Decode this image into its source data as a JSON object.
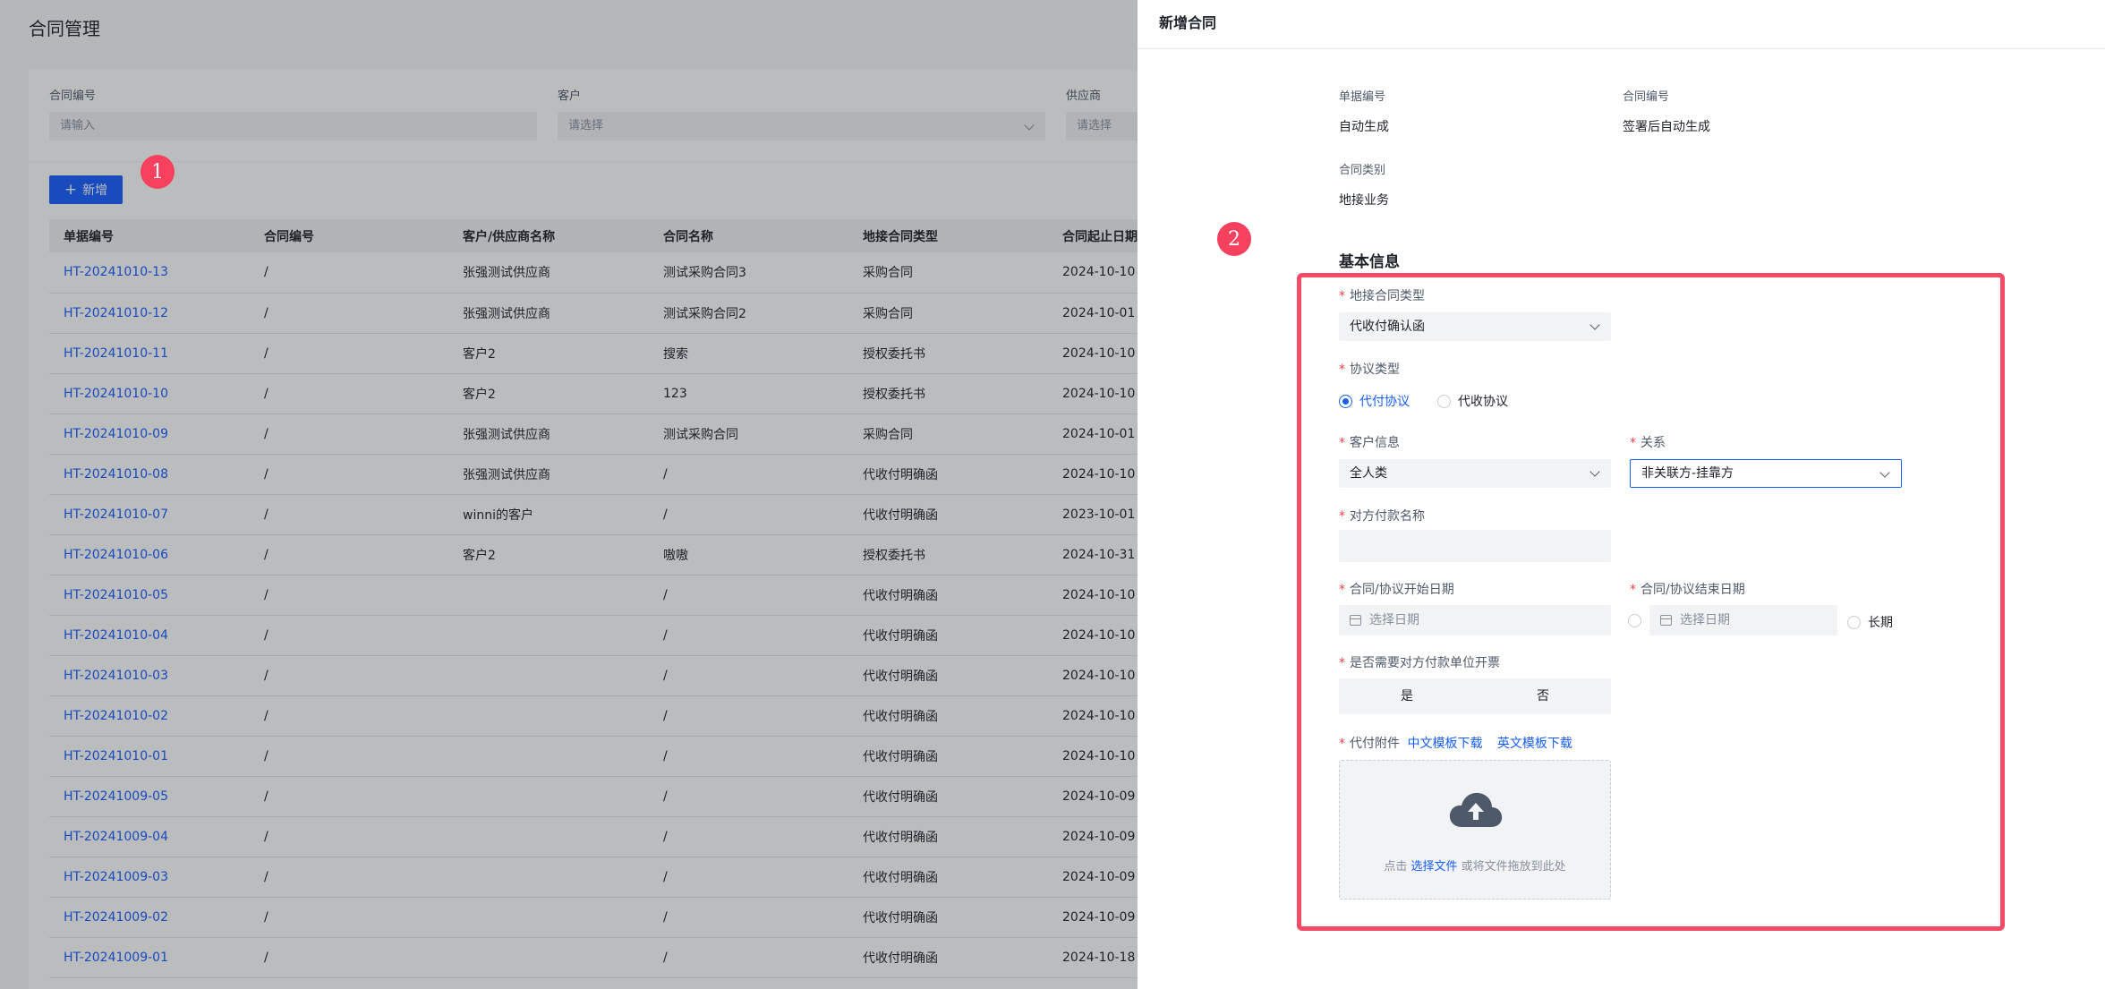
{
  "page": {
    "title": "合同管理"
  },
  "filters": [
    {
      "label": "合同编号",
      "placeholder": "请输入",
      "type": "input"
    },
    {
      "label": "客户",
      "placeholder": "请选择",
      "type": "select"
    },
    {
      "label": "供应商",
      "placeholder": "请选择",
      "type": "select"
    }
  ],
  "toolbar": {
    "add_label": "新增",
    "add_icon": "plus-icon"
  },
  "badges": {
    "step1": "1",
    "step2": "2"
  },
  "table": {
    "columns": [
      "单据编号",
      "合同编号",
      "客户/供应商名称",
      "合同名称",
      "地接合同类型",
      "合同起止日期"
    ],
    "rows": [
      [
        "HT-20241010-13",
        "/",
        "张强测试供应商",
        "测试采购合同3",
        "采购合同",
        "2024-10-10"
      ],
      [
        "HT-20241010-12",
        "/",
        "张强测试供应商",
        "测试采购合同2",
        "采购合同",
        "2024-10-01"
      ],
      [
        "HT-20241010-11",
        "/",
        "客户2",
        "搜索",
        "授权委托书",
        "2024-10-10"
      ],
      [
        "HT-20241010-10",
        "/",
        "客户2",
        "123",
        "授权委托书",
        "2024-10-10"
      ],
      [
        "HT-20241010-09",
        "/",
        "张强测试供应商",
        "测试采购合同",
        "采购合同",
        "2024-10-01"
      ],
      [
        "HT-20241010-08",
        "/",
        "张强测试供应商",
        "/",
        "代收付明确函",
        "2024-10-10"
      ],
      [
        "HT-20241010-07",
        "/",
        "winni的客户",
        "/",
        "代收付明确函",
        "2023-10-01"
      ],
      [
        "HT-20241010-06",
        "/",
        "客户2",
        "嗷嗷",
        "授权委托书",
        "2024-10-31"
      ],
      [
        "HT-20241010-05",
        "/",
        "",
        "/",
        "代收付明确函",
        "2024-10-10"
      ],
      [
        "HT-20241010-04",
        "/",
        "",
        "/",
        "代收付明确函",
        "2024-10-10"
      ],
      [
        "HT-20241010-03",
        "/",
        "",
        "/",
        "代收付明确函",
        "2024-10-10"
      ],
      [
        "HT-20241010-02",
        "/",
        "",
        "/",
        "代收付明确函",
        "2024-10-10"
      ],
      [
        "HT-20241010-01",
        "/",
        "",
        "/",
        "代收付明确函",
        "2024-10-10"
      ],
      [
        "HT-20241009-05",
        "/",
        "",
        "/",
        "代收付明确函",
        "2024-10-09"
      ],
      [
        "HT-20241009-04",
        "/",
        "",
        "/",
        "代收付明确函",
        "2024-10-09"
      ],
      [
        "HT-20241009-03",
        "/",
        "",
        "/",
        "代收付明确函",
        "2024-10-09"
      ],
      [
        "HT-20241009-02",
        "/",
        "",
        "/",
        "代收付明确函",
        "2024-10-09"
      ],
      [
        "HT-20241009-01",
        "/",
        "",
        "/",
        "代收付明确函",
        "2024-10-18"
      ]
    ]
  },
  "drawer": {
    "title": "新增合同",
    "doc_no": {
      "label": "单据编号",
      "value": "自动生成"
    },
    "contract_no": {
      "label": "合同编号",
      "value": "签署后自动生成"
    },
    "category": {
      "label": "合同类别",
      "value": "地接业务"
    },
    "section_title": "基本信息",
    "required_mark": "*",
    "contract_type": {
      "label": "地接合同类型",
      "value": "代收付确认函"
    },
    "agreement_type": {
      "label": "协议类型",
      "options": [
        "代付协议",
        "代收协议"
      ],
      "selected": "代付协议"
    },
    "customer_info": {
      "label": "客户信息",
      "value": "全人类"
    },
    "relation": {
      "label": "关系",
      "value": "非关联方-挂靠方"
    },
    "payer_name": {
      "label": "对方付款名称",
      "value": ""
    },
    "start_date": {
      "label": "合同/协议开始日期",
      "placeholder": "选择日期"
    },
    "end_date": {
      "label": "合同/协议结束日期",
      "placeholder": "选择日期",
      "long_term_label": "长期"
    },
    "invoice": {
      "label": "是否需要对方付款单位开票",
      "options": [
        "是",
        "否"
      ]
    },
    "attachment": {
      "label": "代付附件",
      "cn_template": "中文模板下载",
      "en_template": "英文模板下载",
      "hint_prefix": "点击",
      "hint_link": "选择文件",
      "hint_suffix": "或将文件拖放到此处",
      "icon": "cloud-upload-icon"
    }
  },
  "colors": {
    "primary": "#165dff",
    "danger": "#f53f3f",
    "highlight": "#f24a67",
    "badge": "#f5405e"
  }
}
